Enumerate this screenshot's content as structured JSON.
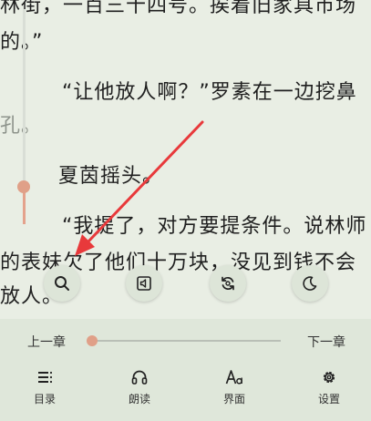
{
  "content": {
    "lines": [
      "林街，一百三十四号。挨着旧家具市场",
      "的。”",
      "“让他放人啊？”罗素在一边挖鼻",
      "孔。",
      "夏茵摇头。",
      "“我提了，对方要提条件。说林师",
      "的表妹欠了他们十万块，没见到钱不会",
      "放人。”"
    ]
  },
  "toolbar": {
    "search_icon": "search-icon",
    "tts_icon": "speaker-icon",
    "autoflip_icon": "refresh-icon",
    "night_icon": "moon-icon"
  },
  "progress": {
    "prev_label": "上一章",
    "next_label": "下一章",
    "chapter_progress": 0.0
  },
  "bottom_nav": [
    {
      "label": "目录",
      "icon": "list-icon"
    },
    {
      "label": "朗读",
      "icon": "headphones-icon"
    },
    {
      "label": "界面",
      "icon": "font-icon"
    },
    {
      "label": "设置",
      "icon": "gear-icon"
    }
  ],
  "colors": {
    "accent": "#e0a088",
    "annotation_arrow": "#e8393b",
    "background": "#e9eee4"
  }
}
